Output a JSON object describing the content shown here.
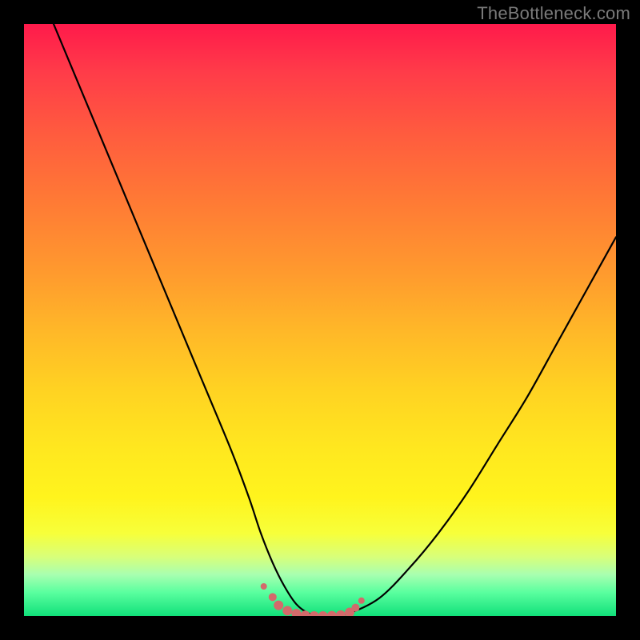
{
  "watermark": "TheBottleneck.com",
  "colors": {
    "frame": "#000000",
    "curve": "#000000",
    "marker": "#d36a6b",
    "gradient_top": "#ff1a4b",
    "gradient_bottom": "#11e07a"
  },
  "chart_data": {
    "type": "line",
    "title": "",
    "xlabel": "",
    "ylabel": "",
    "xlim": [
      0,
      100
    ],
    "ylim": [
      0,
      100
    ],
    "grid": false,
    "legend": false,
    "series": [
      {
        "name": "curve",
        "x": [
          5,
          10,
          15,
          20,
          25,
          30,
          35,
          38,
          40,
          42,
          44,
          46,
          48,
          50,
          52,
          55,
          60,
          65,
          70,
          75,
          80,
          85,
          90,
          95,
          100
        ],
        "y": [
          100,
          88,
          76,
          64,
          52,
          40,
          28,
          20,
          14,
          9,
          5,
          2,
          0.5,
          0,
          0,
          0.5,
          3,
          8,
          14,
          21,
          29,
          37,
          46,
          55,
          64
        ]
      }
    ],
    "markers": {
      "name": "bottom-cluster",
      "color": "#d36a6b",
      "x": [
        40.5,
        42,
        43,
        44.5,
        46,
        47.5,
        49,
        50.5,
        52,
        53.5,
        55,
        56,
        57
      ],
      "y": [
        5,
        3.2,
        1.8,
        0.9,
        0.4,
        0.1,
        0,
        0,
        0.05,
        0.15,
        0.6,
        1.4,
        2.6
      ],
      "r": [
        4,
        5,
        6,
        6,
        6,
        6,
        6,
        6,
        6,
        6,
        6,
        5,
        4
      ]
    }
  }
}
